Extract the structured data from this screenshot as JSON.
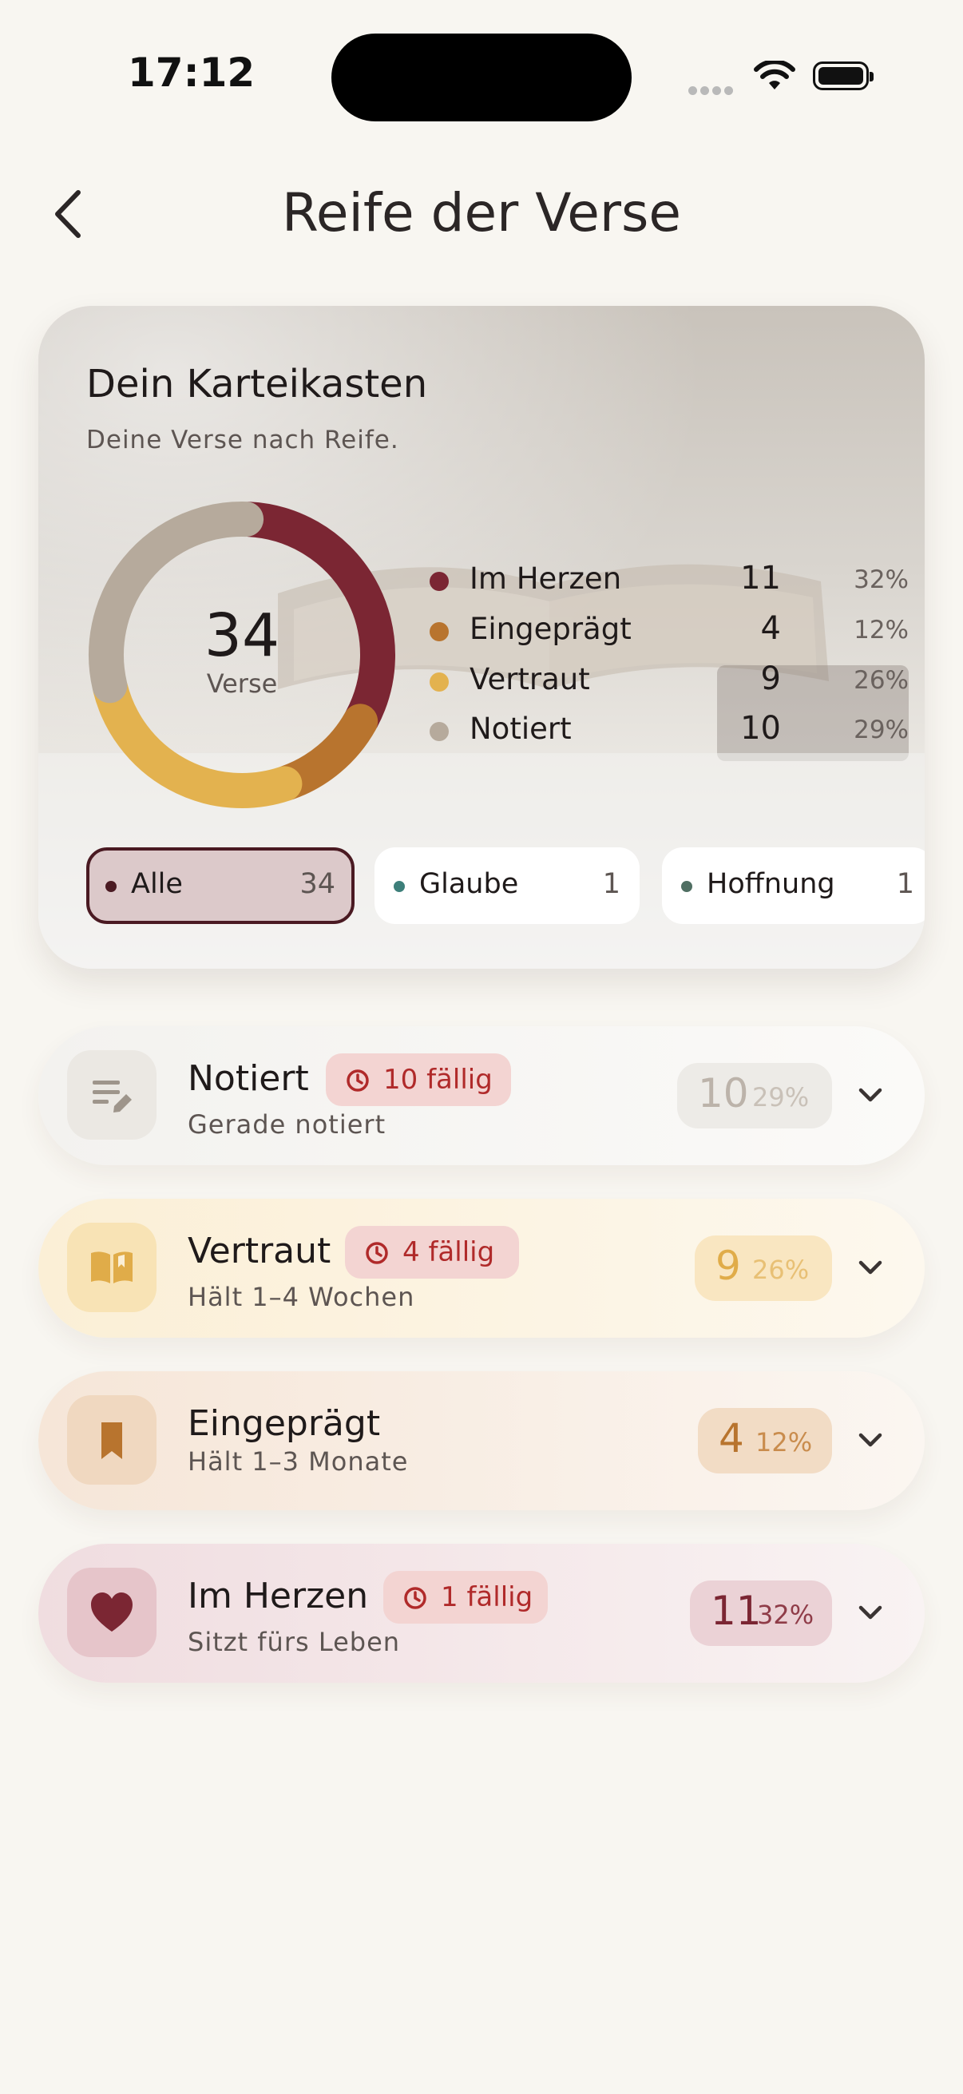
{
  "status_bar": {
    "time": "17:12"
  },
  "header": {
    "title": "Reife der Verse"
  },
  "overview": {
    "title": "Dein Karteikasten",
    "subtitle": "Deine Verse nach Reife.",
    "total": "34",
    "total_label": "Verse",
    "legend": [
      {
        "name": "Im Herzen",
        "count": "11",
        "percent": "32%",
        "color": "#7b2633"
      },
      {
        "name": "Eingeprägt",
        "count": "4",
        "percent": "12%",
        "color": "#b8742e"
      },
      {
        "name": "Vertraut",
        "count": "9",
        "percent": "26%",
        "color": "#e3b24f"
      },
      {
        "name": "Notiert",
        "count": "10",
        "percent": "29%",
        "color": "#b6aa9c"
      }
    ],
    "filters": [
      {
        "label": "Alle",
        "count": "34",
        "dot_color": "#4a1a22",
        "active": true
      },
      {
        "label": "Glaube",
        "count": "1",
        "dot_color": "#3d7f7a",
        "active": false
      },
      {
        "label": "Hoffnung",
        "count": "1",
        "dot_color": "#4f6e62",
        "active": false
      }
    ]
  },
  "stages": [
    {
      "name": "Notiert",
      "due": "10 fällig",
      "description": "Gerade notiert",
      "count": "10",
      "percent": "29%",
      "icon": "note-edit-icon"
    },
    {
      "name": "Vertraut",
      "due": "4 fällig",
      "description": "Hält 1–4 Wochen",
      "count": "9",
      "percent": "26%",
      "icon": "open-book-icon"
    },
    {
      "name": "Eingeprägt",
      "due": "",
      "description": "Hält 1–3 Monate",
      "count": "4",
      "percent": "12%",
      "icon": "bookmark-icon"
    },
    {
      "name": "Im Herzen",
      "due": "1 fällig",
      "description": "Sitzt fürs Leben",
      "count": "11",
      "percent": "32%",
      "icon": "heart-icon"
    }
  ]
}
